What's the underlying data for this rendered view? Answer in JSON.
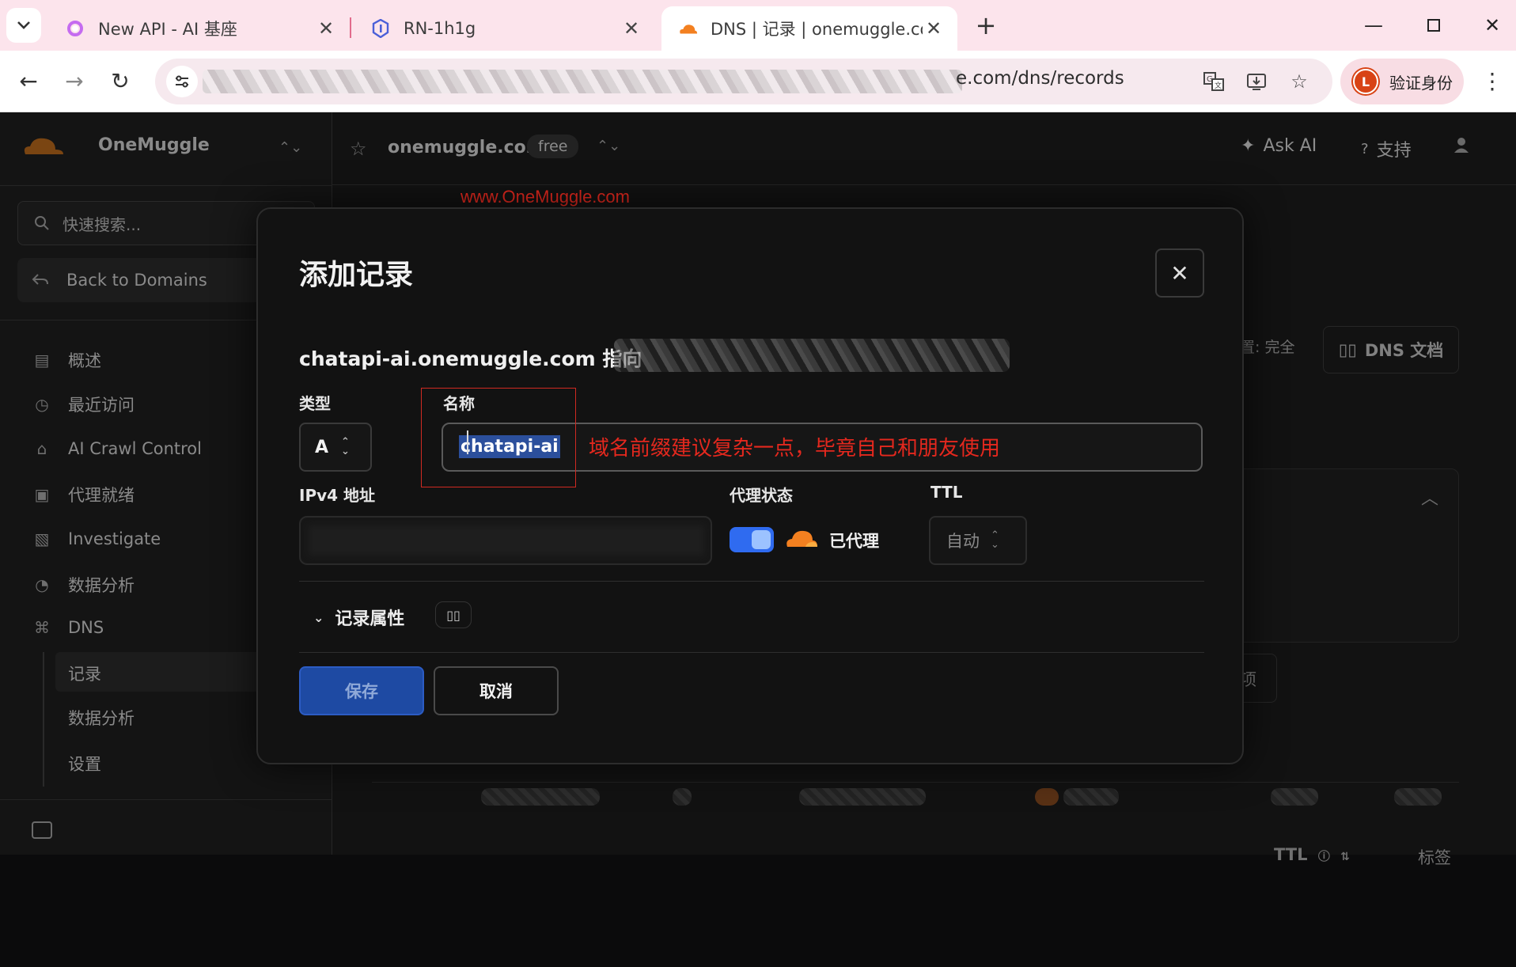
{
  "browser": {
    "tabs": [
      {
        "title": "New API - AI 基座",
        "icon": "newapi-logo-icon",
        "active": false
      },
      {
        "title": "RN-1h1g",
        "icon": "shield-hex-icon",
        "active": false
      },
      {
        "title": "DNS | 记录 | onemuggle.com",
        "icon": "cloudflare-icon",
        "active": true
      }
    ],
    "url_visible": "e.com/dns/records",
    "profile_label": "验证身份",
    "profile_initial": "L"
  },
  "sidebar": {
    "account_name": "OneMuggle",
    "search_placeholder": "快速搜索...",
    "back_label": "Back to Domains",
    "items": [
      {
        "label": "概述",
        "icon": "document-icon"
      },
      {
        "label": "最近访问",
        "icon": "clock-icon"
      },
      {
        "label": "AI Crawl Control",
        "icon": "robot-icon"
      },
      {
        "label": "代理就绪",
        "icon": "proxy-icon"
      },
      {
        "label": "Investigate",
        "icon": "file-search-icon"
      },
      {
        "label": "数据分析",
        "icon": "chart-icon"
      },
      {
        "label": "DNS",
        "icon": "network-icon"
      }
    ],
    "dns_sub": [
      "记录",
      "数据分析",
      "设置"
    ]
  },
  "header": {
    "domain": "onemuggle.com",
    "plan": "free",
    "ask_ai": "Ask AI",
    "support": "支持"
  },
  "background": {
    "badge": "设置: 完全",
    "docs": "DNS 文档",
    "button_fragment": "项",
    "col_ttl": "TTL",
    "col_tags": "标签"
  },
  "watermark": "www.OneMuggle.com",
  "modal": {
    "title": "添加记录",
    "subtitle": "chatapi-ai.onemuggle.com 指向",
    "type_label": "类型",
    "type_value": "A",
    "name_label": "名称",
    "name_value": "chatapi-ai",
    "annotation": "域名前缀建议复杂一点，毕竟自己和朋友使用",
    "ipv4_label": "IPv4 地址",
    "proxy_label": "代理状态",
    "proxy_on": true,
    "proxy_status": "已代理",
    "ttl_label": "TTL",
    "ttl_value": "自动",
    "attributes_label": "记录属性",
    "save": "保存",
    "cancel": "取消"
  },
  "colors": {
    "accent_blue": "#2f6bf0",
    "cloudflare_orange": "#f38020",
    "annotation_red": "#e4281e"
  }
}
